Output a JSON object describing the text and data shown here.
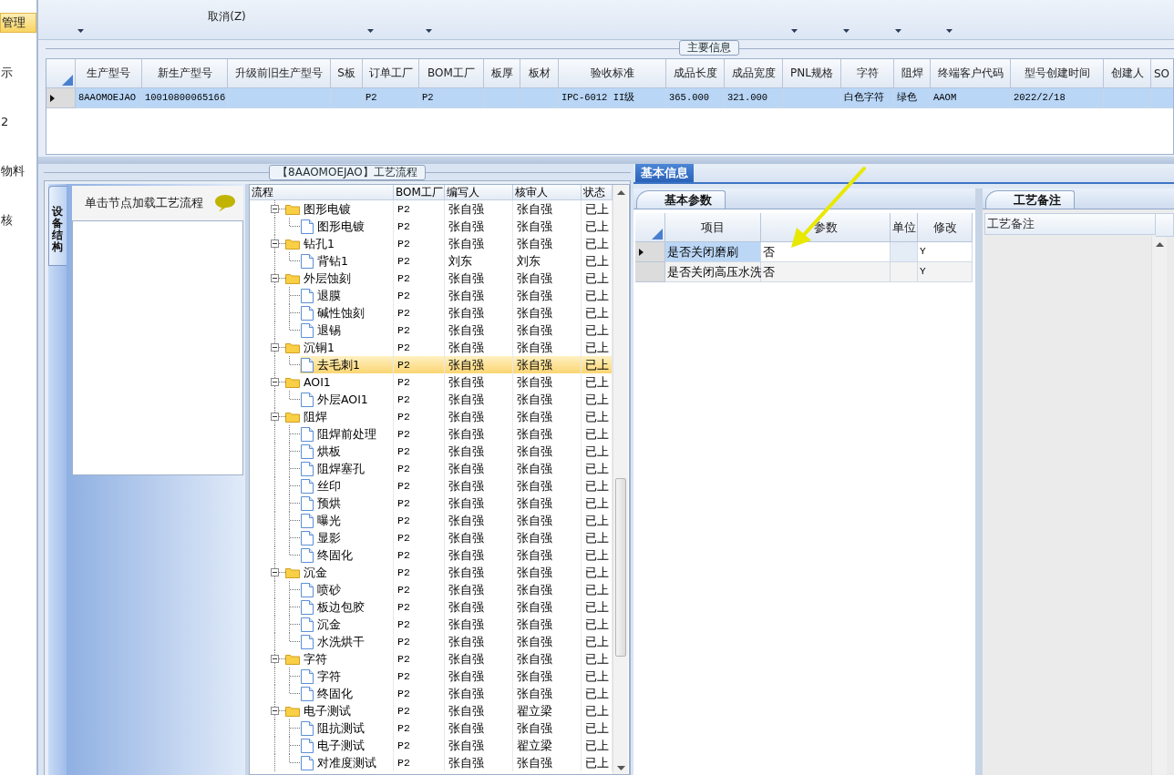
{
  "sidebar": {
    "items": [
      {
        "label": "管理",
        "selected": true
      },
      {
        "label": "示",
        "selected": false
      },
      {
        "label": "2",
        "selected": false
      },
      {
        "label": "物料",
        "selected": false
      },
      {
        "label": "核",
        "selected": false
      }
    ]
  },
  "toolbar": {
    "items": [
      {
        "kind": "dropdown"
      },
      {
        "kind": "button",
        "lines": [
          "取消(Z)"
        ]
      },
      {
        "kind": "dropdown"
      },
      {
        "kind": "dropdown"
      },
      {
        "kind": "dropdown"
      },
      {
        "kind": "dropdown"
      },
      {
        "kind": "dropdown"
      },
      {
        "kind": "dropdown"
      }
    ]
  },
  "main_info": {
    "title": "主要信息",
    "columns": [
      "生产型号",
      "新生产型号",
      "升级前旧生产型号",
      "S板",
      "订单工厂",
      "BOM工厂",
      "板厚",
      "板材",
      "验收标准",
      "成品长度",
      "成品宽度",
      "PNL规格",
      "字符",
      "阻焊",
      "终端客户代码",
      "型号创建时间",
      "创建人",
      "SO"
    ],
    "rows": [
      {
        "selected": true,
        "cells": [
          "8AAOMOEJAO",
          "10010800065166",
          null,
          null,
          "P2",
          "P2",
          null,
          null,
          "IPC-6012 II级",
          "365.000",
          "321.000",
          null,
          "白色字符",
          "绿色",
          "AAOM",
          "2022/2/18",
          null,
          null
        ]
      }
    ]
  },
  "process_panel": {
    "title": "【8AAOMOEJAO】工艺流程",
    "side_tab": "设备结构",
    "hint": "单击节点加载工艺流程",
    "tree": {
      "columns": [
        "流程",
        "BOM工厂",
        "编写人",
        "核审人",
        "状态"
      ],
      "rows": [
        {
          "name": "图形电镀",
          "bom": "P2",
          "writer": "张自强",
          "reviewer": "张自强",
          "status": "已上",
          "selected": false,
          "expanded": true,
          "children": [
            {
              "name": "图形电镀",
              "bom": "P2",
              "writer": "张自强",
              "reviewer": "张自强",
              "status": "已上",
              "selected": false
            }
          ]
        },
        {
          "name": "钻孔1",
          "bom": "P2",
          "writer": "张自强",
          "reviewer": "张自强",
          "status": "已上",
          "selected": false,
          "expanded": true,
          "children": [
            {
              "name": "背钻1",
              "bom": "P2",
              "writer": "刘东",
              "reviewer": "刘东",
              "status": "已上",
              "selected": false
            }
          ]
        },
        {
          "name": "外层蚀刻",
          "bom": "P2",
          "writer": "张自强",
          "reviewer": "张自强",
          "status": "已上",
          "selected": false,
          "expanded": true,
          "children": [
            {
              "name": "退膜",
              "bom": "P2",
              "writer": "张自强",
              "reviewer": "张自强",
              "status": "已上",
              "selected": false
            },
            {
              "name": "碱性蚀刻",
              "bom": "P2",
              "writer": "张自强",
              "reviewer": "张自强",
              "status": "已上",
              "selected": false
            },
            {
              "name": "退锡",
              "bom": "P2",
              "writer": "张自强",
              "reviewer": "张自强",
              "status": "已上",
              "selected": false
            }
          ]
        },
        {
          "name": "沉铜1",
          "bom": "P2",
          "writer": "张自强",
          "reviewer": "张自强",
          "status": "已上",
          "selected": false,
          "expanded": true,
          "children": [
            {
              "name": "去毛刺1",
              "bom": "P2",
              "writer": "张自强",
              "reviewer": "张自强",
              "status": "已上",
              "selected": true
            }
          ]
        },
        {
          "name": "AOI1",
          "bom": "P2",
          "writer": "张自强",
          "reviewer": "张自强",
          "status": "已上",
          "selected": false,
          "expanded": true,
          "children": [
            {
              "name": "外层AOI1",
              "bom": "P2",
              "writer": "张自强",
              "reviewer": "张自强",
              "status": "已上",
              "selected": false
            }
          ]
        },
        {
          "name": "阻焊",
          "bom": "P2",
          "writer": "张自强",
          "reviewer": "张自强",
          "status": "已上",
          "selected": false,
          "expanded": true,
          "children": [
            {
              "name": "阻焊前处理",
              "bom": "P2",
              "writer": "张自强",
              "reviewer": "张自强",
              "status": "已上",
              "selected": false
            },
            {
              "name": "烘板",
              "bom": "P2",
              "writer": "张自强",
              "reviewer": "张自强",
              "status": "已上",
              "selected": false
            },
            {
              "name": "阻焊塞孔",
              "bom": "P2",
              "writer": "张自强",
              "reviewer": "张自强",
              "status": "已上",
              "selected": false
            },
            {
              "name": "丝印",
              "bom": "P2",
              "writer": "张自强",
              "reviewer": "张自强",
              "status": "已上",
              "selected": false
            },
            {
              "name": "预烘",
              "bom": "P2",
              "writer": "张自强",
              "reviewer": "张自强",
              "status": "已上",
              "selected": false
            },
            {
              "name": "曝光",
              "bom": "P2",
              "writer": "张自强",
              "reviewer": "张自强",
              "status": "已上",
              "selected": false
            },
            {
              "name": "显影",
              "bom": "P2",
              "writer": "张自强",
              "reviewer": "张自强",
              "status": "已上",
              "selected": false
            },
            {
              "name": "终固化",
              "bom": "P2",
              "writer": "张自强",
              "reviewer": "张自强",
              "status": "已上",
              "selected": false
            }
          ]
        },
        {
          "name": "沉金",
          "bom": "P2",
          "writer": "张自强",
          "reviewer": "张自强",
          "status": "已上",
          "selected": false,
          "expanded": true,
          "children": [
            {
              "name": "喷砂",
              "bom": "P2",
              "writer": "张自强",
              "reviewer": "张自强",
              "status": "已上",
              "selected": false
            },
            {
              "name": "板边包胶",
              "bom": "P2",
              "writer": "张自强",
              "reviewer": "张自强",
              "status": "已上",
              "selected": false
            },
            {
              "name": "沉金",
              "bom": "P2",
              "writer": "张自强",
              "reviewer": "张自强",
              "status": "已上",
              "selected": false
            },
            {
              "name": "水洗烘干",
              "bom": "P2",
              "writer": "张自强",
              "reviewer": "张自强",
              "status": "已上",
              "selected": false
            }
          ]
        },
        {
          "name": "字符",
          "bom": "P2",
          "writer": "张自强",
          "reviewer": "张自强",
          "status": "已上",
          "selected": false,
          "expanded": true,
          "children": [
            {
              "name": "字符",
              "bom": "P2",
              "writer": "张自强",
              "reviewer": "张自强",
              "status": "已上",
              "selected": false
            },
            {
              "name": "终固化",
              "bom": "P2",
              "writer": "张自强",
              "reviewer": "张自强",
              "status": "已上",
              "selected": false
            }
          ]
        },
        {
          "name": "电子测试",
          "bom": "P2",
          "writer": "张自强",
          "reviewer": "翟立梁",
          "status": "已上",
          "selected": false,
          "expanded": true,
          "children": [
            {
              "name": "阻抗测试",
              "bom": "P2",
              "writer": "张自强",
              "reviewer": "张自强",
              "status": "已上",
              "selected": false
            },
            {
              "name": "电子测试",
              "bom": "P2",
              "writer": "张自强",
              "reviewer": "翟立梁",
              "status": "已上",
              "selected": false
            },
            {
              "name": "对准度测试",
              "bom": "P2",
              "writer": "张自强",
              "reviewer": "张自强",
              "status": "已上",
              "selected": false
            }
          ]
        }
      ]
    }
  },
  "info_panel": {
    "tabs": [
      {
        "label": "基本信息",
        "selected": true
      }
    ],
    "params": {
      "tabs": [
        {
          "label": "基本参数",
          "selected": true
        }
      ],
      "columns": [
        "项目",
        "参数",
        "单位",
        "修改"
      ],
      "rows": [
        {
          "item": "是否关闭磨刷",
          "value": "否",
          "modify": "Y",
          "selected": true
        },
        {
          "item": "是否关闭高压水洗",
          "value": "否",
          "modify": "Y",
          "selected": false
        }
      ]
    },
    "notes": {
      "tabs": [
        {
          "label": "工艺备注",
          "selected": true
        }
      ],
      "columns": [
        "工艺备注"
      ]
    }
  }
}
